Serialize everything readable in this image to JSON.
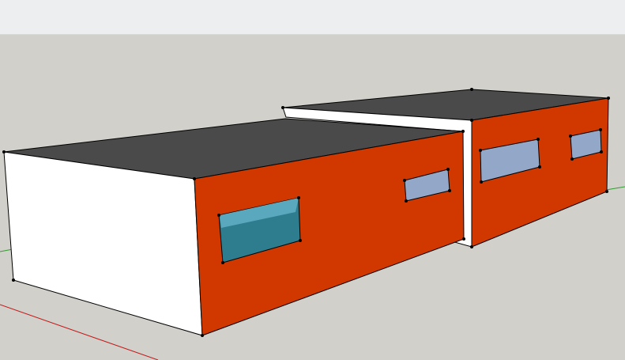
{
  "viewport": {
    "background": "#d1d0cb",
    "toolbar_background": "#edeeef"
  },
  "model": {
    "roof_color": "#4a4a4a",
    "wall_color": "#d03800",
    "side_wall_color": "#ffffff",
    "window_glass_color": "#93a8c8",
    "selected_window_color": "#2e7d8f",
    "edge_color": "#000000"
  },
  "axes": {
    "red_axis_color": "#c41a1a",
    "green_axis_color": "#2e9e2e"
  }
}
